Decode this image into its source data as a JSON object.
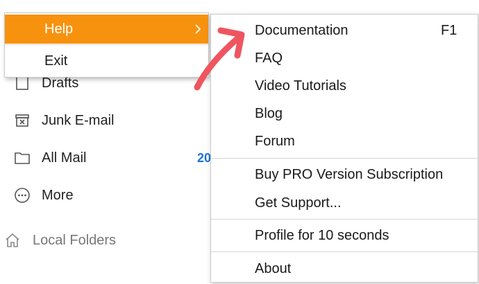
{
  "folders": [
    {
      "label": "Drafts",
      "icon": "drafts-icon",
      "count": ""
    },
    {
      "label": "Junk E-mail",
      "icon": "junk-icon",
      "count": ""
    },
    {
      "label": "All Mail",
      "icon": "folder-icon",
      "count": "20"
    },
    {
      "label": "More",
      "icon": "more-icon",
      "count": ""
    }
  ],
  "section": {
    "label": "Local Folders",
    "icon": "home-icon"
  },
  "main_menu": {
    "help_label": "Help",
    "exit_label": "Exit",
    "highlight_color": "#f7920f"
  },
  "help_submenu": {
    "items": [
      {
        "label": "Documentation",
        "shortcut": "F1"
      },
      {
        "label": "FAQ"
      },
      {
        "label": "Video Tutorials"
      },
      {
        "label": "Blog"
      },
      {
        "label": "Forum"
      },
      {
        "label": "Buy PRO Version Subscription"
      },
      {
        "label": "Get Support..."
      },
      {
        "label": "Profile for 10 seconds"
      },
      {
        "label": "About"
      }
    ]
  },
  "annotation": {
    "arrow_color": "#ef5560",
    "icon": "annotation-arrow-icon"
  },
  "colors": {
    "count_blue": "#1a73d9"
  }
}
